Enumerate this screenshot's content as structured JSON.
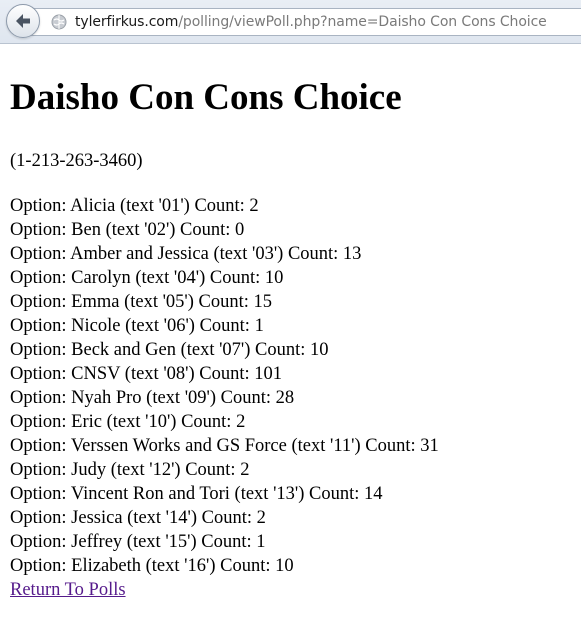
{
  "browser": {
    "url_domain": "tylerfirkus.com",
    "url_path": "/polling/viewPoll.php?name=Daisho Con Cons Choice"
  },
  "page": {
    "title": "Daisho Con Cons Choice",
    "phone": "(1-213-263-3460)",
    "options": [
      "Option: Alicia (text '01') Count: 2",
      "Option: Ben (text '02') Count: 0",
      "Option: Amber and Jessica (text '03') Count: 13",
      "Option: Carolyn (text '04') Count: 10",
      "Option: Emma (text '05') Count: 15",
      "Option: Nicole (text '06') Count: 1",
      "Option: Beck and Gen (text '07') Count: 10",
      "Option: CNSV (text '08') Count: 101",
      "Option: Nyah Pro (text '09') Count: 28",
      "Option: Eric (text '10') Count: 2",
      "Option: Verssen Works and GS Force (text '11') Count: 31",
      "Option: Judy (text '12') Count: 2",
      "Option: Vincent Ron and Tori (text '13') Count: 14",
      "Option: Jessica (text '14') Count: 2",
      "Option: Jeffrey (text '15') Count: 1",
      "Option: Elizabeth (text '16') Count: 10"
    ],
    "return_link": "Return To Polls"
  },
  "colors": {
    "link_visited": "#551a8b",
    "toolbar": "#e3e9f1"
  },
  "icons": {
    "back": "back-arrow-icon",
    "site": "globe-icon"
  }
}
